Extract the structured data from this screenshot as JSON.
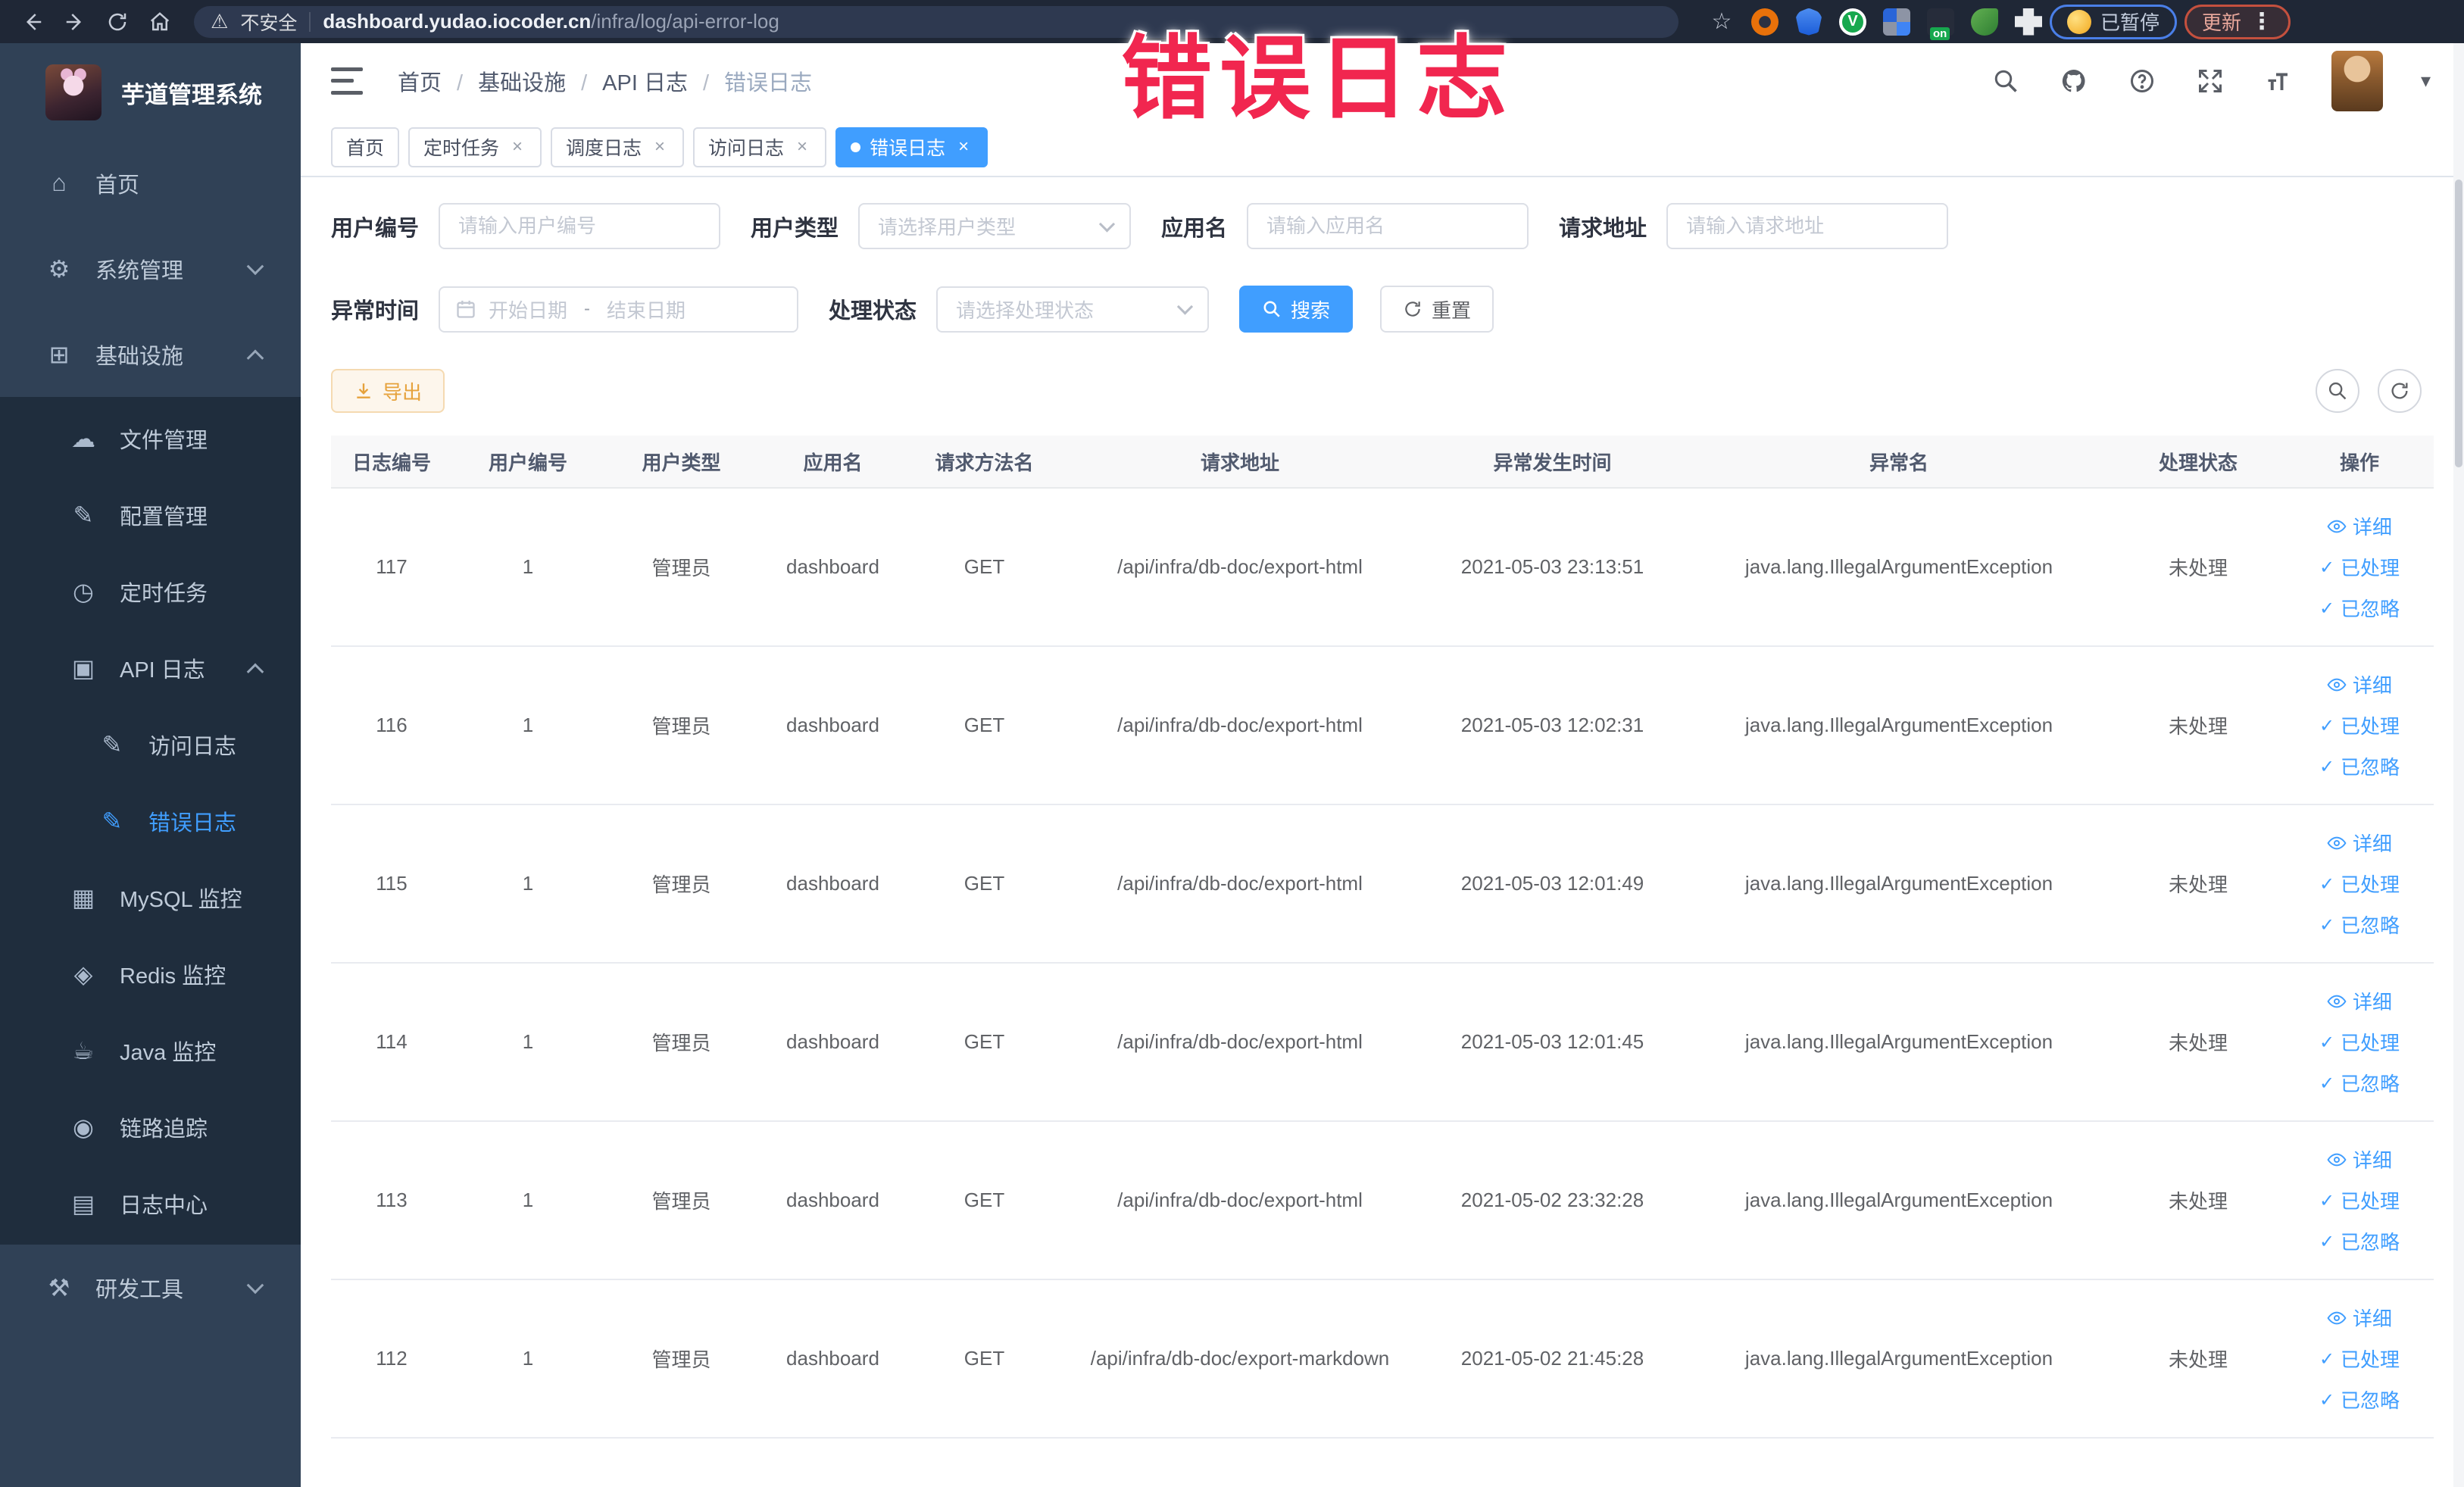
{
  "browser": {
    "security_label": "不安全",
    "url_domain": "dashboard.yudao.iocoder.cn",
    "url_path": "/infra/log/api-error-log",
    "paused_badge": "已暂停",
    "update_badge": "更新"
  },
  "watermark": "错误日志",
  "colors": {
    "accent": "#409eff",
    "sidebar_bg": "#304156",
    "submenu_bg": "#1f2d3d",
    "export_text": "#e6a23c",
    "watermark_red": "#f1264f"
  },
  "icons": {
    "home": "⌂",
    "gear": "⚙",
    "infra": "⊞",
    "upload-cloud": "☁",
    "config-edit": "✎",
    "timer": "◷",
    "api-log": "▣",
    "access-log": "✎",
    "error-log": "✎",
    "mysql": "▦",
    "redis": "◈",
    "java": "☕",
    "trace": "◉",
    "log-center": "▤",
    "dev-tools": "⚒"
  },
  "sidebar": {
    "title": "芋道管理系统",
    "items_top": [
      {
        "label": "首页",
        "icon": "home"
      },
      {
        "label": "系统管理",
        "icon": "gear",
        "chevron": "down"
      },
      {
        "label": "基础设施",
        "icon": "infra",
        "chevron": "up"
      }
    ],
    "items_sub": [
      {
        "label": "文件管理",
        "icon": "upload-cloud",
        "level": 1
      },
      {
        "label": "配置管理",
        "icon": "config-edit",
        "level": 1
      },
      {
        "label": "定时任务",
        "icon": "timer",
        "level": 1
      },
      {
        "label": "API 日志",
        "icon": "api-log",
        "level": 1,
        "chevron": "up"
      },
      {
        "label": "访问日志",
        "icon": "access-log",
        "level": 2
      },
      {
        "label": "错误日志",
        "icon": "error-log",
        "level": 2,
        "active": true
      },
      {
        "label": "MySQL 监控",
        "icon": "mysql",
        "level": 1
      },
      {
        "label": "Redis 监控",
        "icon": "redis",
        "level": 1
      },
      {
        "label": "Java 监控",
        "icon": "java",
        "level": 1
      },
      {
        "label": "链路追踪",
        "icon": "trace",
        "level": 1
      },
      {
        "label": "日志中心",
        "icon": "log-center",
        "level": 1
      }
    ],
    "items_bottom": [
      {
        "label": "研发工具",
        "icon": "dev-tools",
        "chevron": "down"
      }
    ]
  },
  "header": {
    "breadcrumb": [
      {
        "label": "首页"
      },
      {
        "label": "基础设施"
      },
      {
        "label": "API 日志"
      },
      {
        "label": "错误日志",
        "current": true
      }
    ]
  },
  "tabs": [
    {
      "label": "首页"
    },
    {
      "label": "定时任务",
      "closable": true
    },
    {
      "label": "调度日志",
      "closable": true
    },
    {
      "label": "访问日志",
      "closable": true
    },
    {
      "label": "错误日志",
      "closable": true,
      "active": true
    }
  ],
  "filters": {
    "user_id": {
      "label": "用户编号",
      "placeholder": "请输入用户编号"
    },
    "user_type": {
      "label": "用户类型",
      "placeholder": "请选择用户类型"
    },
    "app_name": {
      "label": "应用名",
      "placeholder": "请输入应用名"
    },
    "request_url": {
      "label": "请求地址",
      "placeholder": "请输入请求地址"
    },
    "exception_time": {
      "label": "异常时间",
      "start_placeholder": "开始日期",
      "separator": "-",
      "end_placeholder": "结束日期"
    },
    "process_status": {
      "label": "处理状态",
      "placeholder": "请选择处理状态"
    },
    "search_label": "搜索",
    "reset_label": "重置"
  },
  "toolbar": {
    "export_label": "导出"
  },
  "table": {
    "columns": [
      "日志编号",
      "用户编号",
      "用户类型",
      "应用名",
      "请求方法名",
      "请求地址",
      "异常发生时间",
      "异常名",
      "处理状态",
      "操作"
    ],
    "actions": [
      {
        "label": "详细",
        "icon": "eye"
      },
      {
        "label": "已处理",
        "icon": "check"
      },
      {
        "label": "已忽略",
        "icon": "check"
      }
    ],
    "rows": [
      {
        "id": "117",
        "user_id": "1",
        "user_type": "管理员",
        "app": "dashboard",
        "method": "GET",
        "url": "/api/infra/db-doc/export-html",
        "time": "2021-05-03 23:13:51",
        "exception": "java.lang.IllegalArgumentException",
        "status": "未处理"
      },
      {
        "id": "116",
        "user_id": "1",
        "user_type": "管理员",
        "app": "dashboard",
        "method": "GET",
        "url": "/api/infra/db-doc/export-html",
        "time": "2021-05-03 12:02:31",
        "exception": "java.lang.IllegalArgumentException",
        "status": "未处理"
      },
      {
        "id": "115",
        "user_id": "1",
        "user_type": "管理员",
        "app": "dashboard",
        "method": "GET",
        "url": "/api/infra/db-doc/export-html",
        "time": "2021-05-03 12:01:49",
        "exception": "java.lang.IllegalArgumentException",
        "status": "未处理"
      },
      {
        "id": "114",
        "user_id": "1",
        "user_type": "管理员",
        "app": "dashboard",
        "method": "GET",
        "url": "/api/infra/db-doc/export-html",
        "time": "2021-05-03 12:01:45",
        "exception": "java.lang.IllegalArgumentException",
        "status": "未处理"
      },
      {
        "id": "113",
        "user_id": "1",
        "user_type": "管理员",
        "app": "dashboard",
        "method": "GET",
        "url": "/api/infra/db-doc/export-html",
        "time": "2021-05-02 23:32:28",
        "exception": "java.lang.IllegalArgumentException",
        "status": "未处理"
      },
      {
        "id": "112",
        "user_id": "1",
        "user_type": "管理员",
        "app": "dashboard",
        "method": "GET",
        "url": "/api/infra/db-doc/export-markdown",
        "time": "2021-05-02 21:45:28",
        "exception": "java.lang.IllegalArgumentException",
        "status": "未处理"
      }
    ]
  }
}
